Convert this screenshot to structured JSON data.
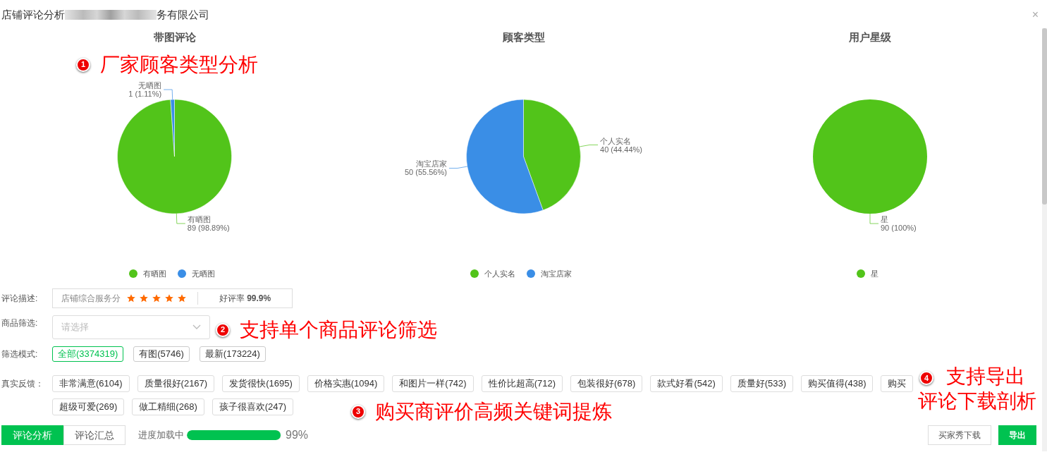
{
  "window": {
    "title_start": "店铺评论分析",
    "title_end": "务有限公司",
    "close": "×"
  },
  "charts": [
    {
      "title": "带图评论",
      "chart_data": {
        "type": "pie",
        "categories": [
          "有晒图",
          "无晒图"
        ],
        "values": [
          89,
          1
        ],
        "colors": [
          "#52c41a",
          "#3a8ee6"
        ],
        "value_labels": [
          "89 (98.89%)",
          "1 (1.11%)"
        ],
        "legend": true
      }
    },
    {
      "title": "顾客类型",
      "chart_data": {
        "type": "pie",
        "categories": [
          "个人实名",
          "淘宝店家"
        ],
        "values": [
          40,
          50
        ],
        "colors": [
          "#52c41a",
          "#3a8ee6"
        ],
        "value_labels": [
          "40 (44.44%)",
          "50 (55.56%)"
        ],
        "legend": true
      }
    },
    {
      "title": "用户星级",
      "chart_data": {
        "type": "pie",
        "categories": [
          "星"
        ],
        "values": [
          90
        ],
        "colors": [
          "#52c41a"
        ],
        "value_labels": [
          "90 (100%)"
        ],
        "legend": true
      }
    }
  ],
  "review_summary": {
    "label": "评论描述:",
    "score_label": "店铺综合服务分",
    "stars": 5,
    "rating": "好评率 **99.9%**"
  },
  "product_filter": {
    "label": "商品筛选:",
    "placeholder": "请选择"
  },
  "filter_mode": {
    "label": "筛选模式:",
    "options": [
      {
        "text": "全部(3374319)",
        "selected": true
      },
      {
        "text": "有图(5746)",
        "selected": false
      },
      {
        "text": "最新(173224)",
        "selected": false
      }
    ]
  },
  "feedback": {
    "label": "真实反馈：",
    "tags": [
      "非常满意(6104)",
      "质量很好(2167)",
      "发货很快(1695)",
      "价格实惠(1094)",
      "和图片一样(742)",
      "性价比超高(712)",
      "包装很好(678)",
      "款式好看(542)",
      "质量好(533)",
      "购买值得(438)",
      "购买",
      "超级可爱(269)",
      "做工精细(268)",
      "孩子很喜欢(247)"
    ]
  },
  "tabs": [
    {
      "label": "评论分析",
      "selected": true
    },
    {
      "label": "评论汇总",
      "selected": false
    }
  ],
  "progress": {
    "label": "进度加载中",
    "level": 0.99,
    "reading": "99%"
  },
  "buttons": [
    {
      "label": "买家秀下载",
      "kind": "outline"
    },
    {
      "label": "导出",
      "kind": "primary"
    }
  ],
  "annotations": [
    {
      "number": "1",
      "lines": [
        "厂家顾客类型分析"
      ]
    },
    {
      "number": "2",
      "lines": [
        "支持单个商品评论筛选"
      ]
    },
    {
      "number": "3",
      "lines": [
        "购买商评价高频关键词提炼"
      ]
    },
    {
      "number": "4",
      "lines": [
        "支持导出",
        "评论下载剖析"
      ]
    }
  ]
}
